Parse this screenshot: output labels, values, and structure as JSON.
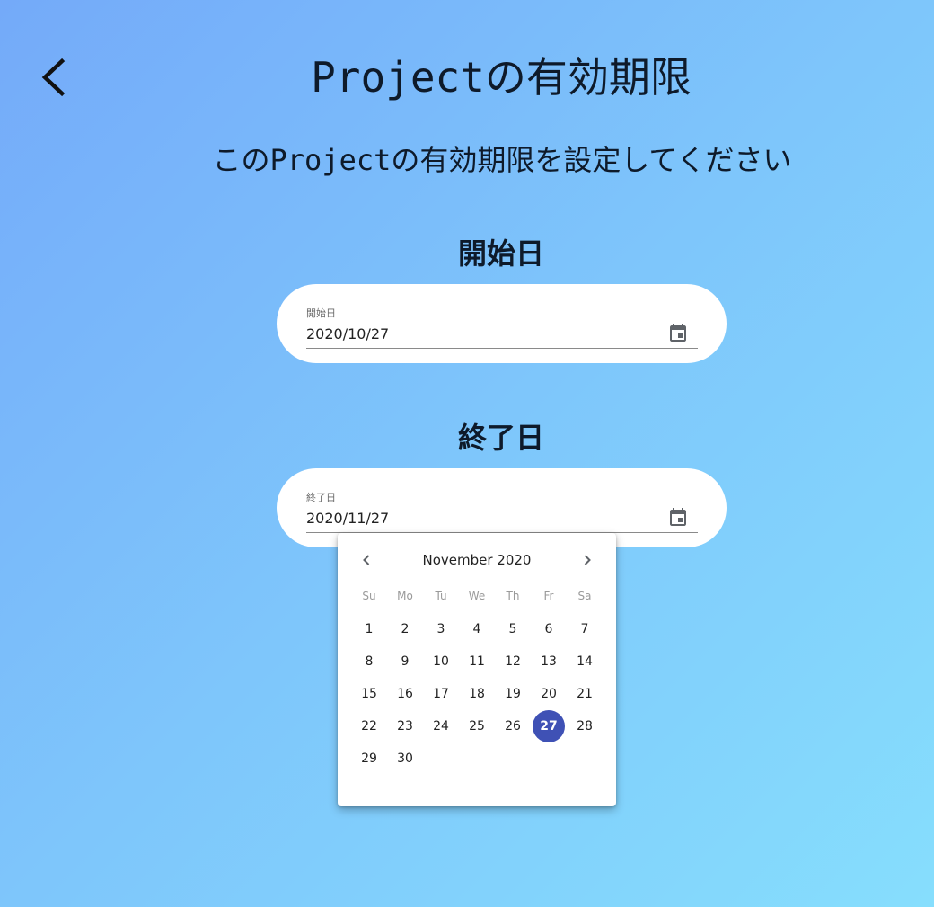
{
  "header": {
    "title": "Projectの有効期限",
    "subtitle": "このProjectの有効期限を設定してください",
    "back_icon": "chevron-left-icon"
  },
  "start": {
    "heading": "開始日",
    "field_label": "開始日",
    "value": "2020/10/27",
    "icon": "calendar-icon"
  },
  "end": {
    "heading": "終了日",
    "field_label": "終了日",
    "value": "2020/11/27",
    "icon": "calendar-icon"
  },
  "calendar": {
    "month_label": "November 2020",
    "prev_icon": "chevron-left-icon",
    "next_icon": "chevron-right-icon",
    "weekdays": [
      "Su",
      "Mo",
      "Tu",
      "We",
      "Th",
      "Fr",
      "Sa"
    ],
    "first_weekday_index": 0,
    "days_in_month": 30,
    "selected_day": 27,
    "selected_color": "#3f51b5"
  },
  "colors": {
    "background_start": "#74aaf9",
    "background_end": "#86defd",
    "card": "#ffffff",
    "text": "#0e1a2a"
  }
}
